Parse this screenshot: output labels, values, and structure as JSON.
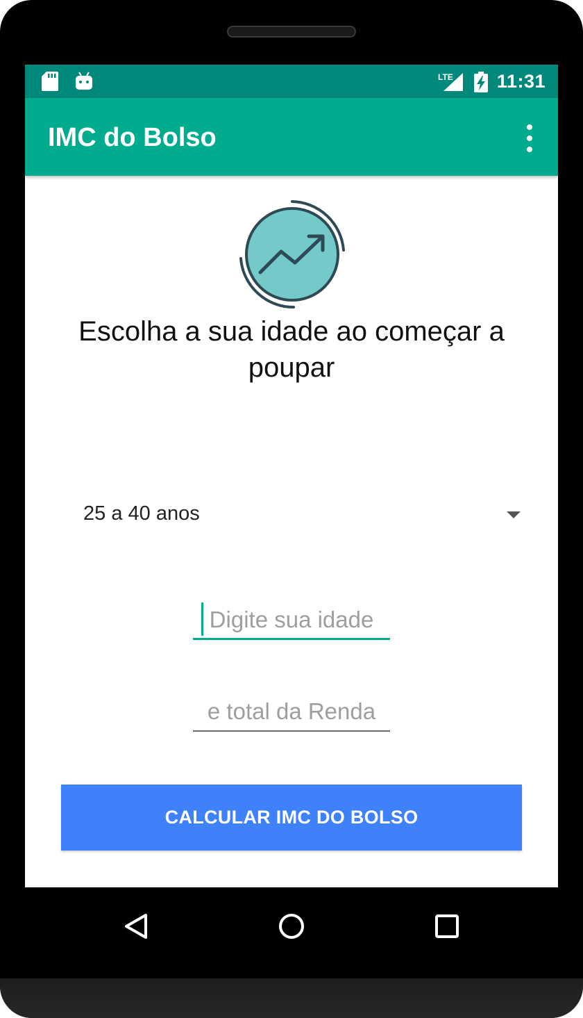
{
  "status_bar": {
    "time": "11:31",
    "icons": [
      "sd-card-icon",
      "android-icon",
      "lte-signal-icon",
      "battery-charging-icon"
    ],
    "network_label": "LTE"
  },
  "app_bar": {
    "title": "IMC do Bolso",
    "menu_icon": "more-vert-icon"
  },
  "main": {
    "hero_icon": "trending-up-chart-icon",
    "headline": "Escolha a sua idade ao começar a poupar",
    "age_range_spinner": {
      "selected": "25 a 40 anos"
    },
    "age_input": {
      "placeholder": "Digite sua idade",
      "value": ""
    },
    "income_input": {
      "placeholder": "e total da Renda",
      "value": ""
    },
    "calculate_button": "CALCULAR IMC DO BOLSO"
  },
  "nav_bar": {
    "icons": [
      "back-icon",
      "home-icon",
      "recents-icon"
    ]
  },
  "colors": {
    "status_bar": "#00897b",
    "app_bar": "#00ab8e",
    "accent": "#00ab8e",
    "button": "#3f80fb",
    "icon_fill": "#74c9c9",
    "icon_stroke": "#2d4a55"
  }
}
